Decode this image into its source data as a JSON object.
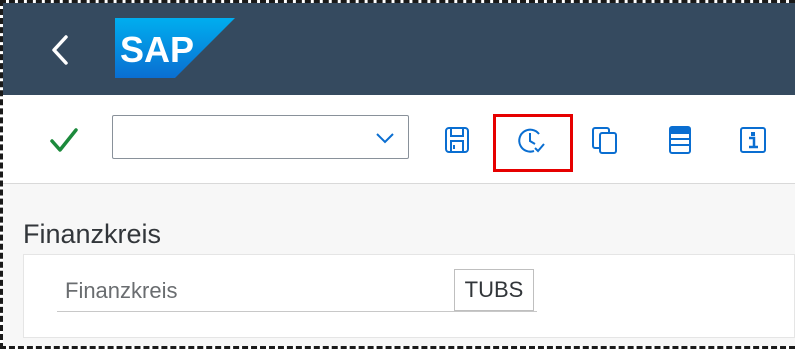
{
  "shell": {
    "back_icon": "chevron-left-icon",
    "logo_text": "SAP",
    "brand_color": "#354a5f",
    "logo_color": "#0a6ed1"
  },
  "toolbar": {
    "enter_icon": "check-icon",
    "command_field_value": "",
    "dropdown_icon": "chevron-down-icon",
    "buttons": [
      {
        "name": "save",
        "icon": "save-icon"
      },
      {
        "name": "schedule",
        "icon": "clock-check-icon",
        "highlighted": true
      },
      {
        "name": "copy",
        "icon": "copy-icon"
      },
      {
        "name": "layout",
        "icon": "layout-icon"
      },
      {
        "name": "info",
        "icon": "info-icon"
      }
    ],
    "highlight_color": "#e60000"
  },
  "content": {
    "section_title": "Finanzkreis",
    "fields": [
      {
        "label": "Finanzkreis",
        "value": "TUBS"
      }
    ]
  }
}
